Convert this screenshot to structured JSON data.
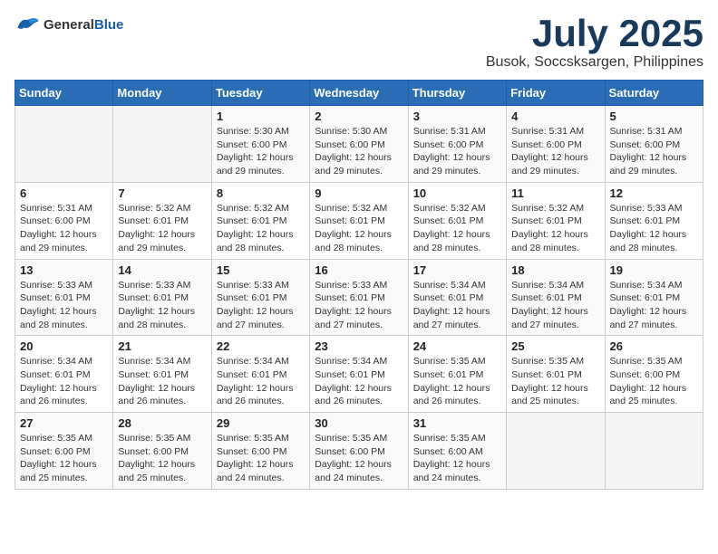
{
  "header": {
    "logo": {
      "general": "General",
      "blue": "Blue"
    },
    "month": "July 2025",
    "location": "Busok, Soccsksargen, Philippines"
  },
  "weekdays": [
    "Sunday",
    "Monday",
    "Tuesday",
    "Wednesday",
    "Thursday",
    "Friday",
    "Saturday"
  ],
  "weeks": [
    [
      {
        "day": null,
        "info": null
      },
      {
        "day": null,
        "info": null
      },
      {
        "day": "1",
        "info": "Sunrise: 5:30 AM\nSunset: 6:00 PM\nDaylight: 12 hours\nand 29 minutes."
      },
      {
        "day": "2",
        "info": "Sunrise: 5:30 AM\nSunset: 6:00 PM\nDaylight: 12 hours\nand 29 minutes."
      },
      {
        "day": "3",
        "info": "Sunrise: 5:31 AM\nSunset: 6:00 PM\nDaylight: 12 hours\nand 29 minutes."
      },
      {
        "day": "4",
        "info": "Sunrise: 5:31 AM\nSunset: 6:00 PM\nDaylight: 12 hours\nand 29 minutes."
      },
      {
        "day": "5",
        "info": "Sunrise: 5:31 AM\nSunset: 6:00 PM\nDaylight: 12 hours\nand 29 minutes."
      }
    ],
    [
      {
        "day": "6",
        "info": "Sunrise: 5:31 AM\nSunset: 6:00 PM\nDaylight: 12 hours\nand 29 minutes."
      },
      {
        "day": "7",
        "info": "Sunrise: 5:32 AM\nSunset: 6:01 PM\nDaylight: 12 hours\nand 29 minutes."
      },
      {
        "day": "8",
        "info": "Sunrise: 5:32 AM\nSunset: 6:01 PM\nDaylight: 12 hours\nand 28 minutes."
      },
      {
        "day": "9",
        "info": "Sunrise: 5:32 AM\nSunset: 6:01 PM\nDaylight: 12 hours\nand 28 minutes."
      },
      {
        "day": "10",
        "info": "Sunrise: 5:32 AM\nSunset: 6:01 PM\nDaylight: 12 hours\nand 28 minutes."
      },
      {
        "day": "11",
        "info": "Sunrise: 5:32 AM\nSunset: 6:01 PM\nDaylight: 12 hours\nand 28 minutes."
      },
      {
        "day": "12",
        "info": "Sunrise: 5:33 AM\nSunset: 6:01 PM\nDaylight: 12 hours\nand 28 minutes."
      }
    ],
    [
      {
        "day": "13",
        "info": "Sunrise: 5:33 AM\nSunset: 6:01 PM\nDaylight: 12 hours\nand 28 minutes."
      },
      {
        "day": "14",
        "info": "Sunrise: 5:33 AM\nSunset: 6:01 PM\nDaylight: 12 hours\nand 28 minutes."
      },
      {
        "day": "15",
        "info": "Sunrise: 5:33 AM\nSunset: 6:01 PM\nDaylight: 12 hours\nand 27 minutes."
      },
      {
        "day": "16",
        "info": "Sunrise: 5:33 AM\nSunset: 6:01 PM\nDaylight: 12 hours\nand 27 minutes."
      },
      {
        "day": "17",
        "info": "Sunrise: 5:34 AM\nSunset: 6:01 PM\nDaylight: 12 hours\nand 27 minutes."
      },
      {
        "day": "18",
        "info": "Sunrise: 5:34 AM\nSunset: 6:01 PM\nDaylight: 12 hours\nand 27 minutes."
      },
      {
        "day": "19",
        "info": "Sunrise: 5:34 AM\nSunset: 6:01 PM\nDaylight: 12 hours\nand 27 minutes."
      }
    ],
    [
      {
        "day": "20",
        "info": "Sunrise: 5:34 AM\nSunset: 6:01 PM\nDaylight: 12 hours\nand 26 minutes."
      },
      {
        "day": "21",
        "info": "Sunrise: 5:34 AM\nSunset: 6:01 PM\nDaylight: 12 hours\nand 26 minutes."
      },
      {
        "day": "22",
        "info": "Sunrise: 5:34 AM\nSunset: 6:01 PM\nDaylight: 12 hours\nand 26 minutes."
      },
      {
        "day": "23",
        "info": "Sunrise: 5:34 AM\nSunset: 6:01 PM\nDaylight: 12 hours\nand 26 minutes."
      },
      {
        "day": "24",
        "info": "Sunrise: 5:35 AM\nSunset: 6:01 PM\nDaylight: 12 hours\nand 26 minutes."
      },
      {
        "day": "25",
        "info": "Sunrise: 5:35 AM\nSunset: 6:01 PM\nDaylight: 12 hours\nand 25 minutes."
      },
      {
        "day": "26",
        "info": "Sunrise: 5:35 AM\nSunset: 6:00 PM\nDaylight: 12 hours\nand 25 minutes."
      }
    ],
    [
      {
        "day": "27",
        "info": "Sunrise: 5:35 AM\nSunset: 6:00 PM\nDaylight: 12 hours\nand 25 minutes."
      },
      {
        "day": "28",
        "info": "Sunrise: 5:35 AM\nSunset: 6:00 PM\nDaylight: 12 hours\nand 25 minutes."
      },
      {
        "day": "29",
        "info": "Sunrise: 5:35 AM\nSunset: 6:00 PM\nDaylight: 12 hours\nand 24 minutes."
      },
      {
        "day": "30",
        "info": "Sunrise: 5:35 AM\nSunset: 6:00 PM\nDaylight: 12 hours\nand 24 minutes."
      },
      {
        "day": "31",
        "info": "Sunrise: 5:35 AM\nSunset: 6:00 AM\nDaylight: 12 hours\nand 24 minutes."
      },
      {
        "day": null,
        "info": null
      },
      {
        "day": null,
        "info": null
      }
    ]
  ]
}
